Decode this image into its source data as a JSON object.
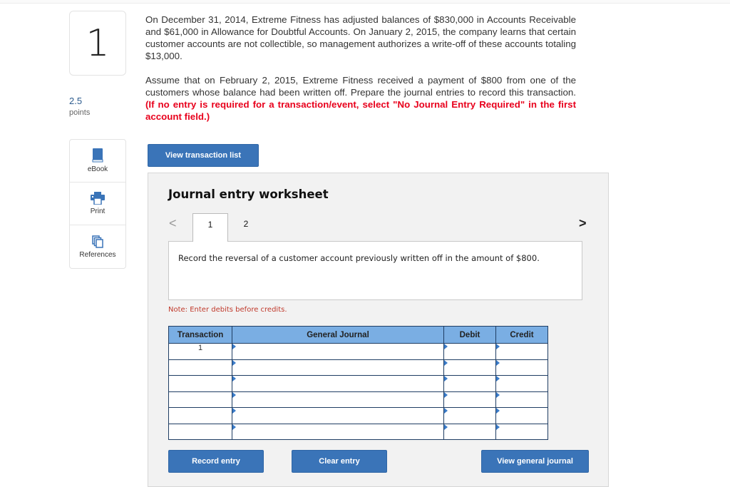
{
  "question": {
    "number": "1",
    "points_value": "2.5",
    "points_label": "points",
    "paragraph1": "On December 31, 2014, Extreme Fitness has adjusted balances of $830,000 in Accounts Receivable and $61,000 in Allowance for Doubtful Accounts. On January 2, 2015, the company learns that certain customer accounts are not collectible, so management authorizes a write-off of these accounts totaling $13,000.",
    "paragraph2_plain": "Assume that on February 2, 2015, Extreme Fitness received a payment of $800 from one of the customers whose balance had been written off. Prepare the journal entries to record this transaction.",
    "paragraph2_instruction": "(If no entry is required for a transaction/event, select \"No Journal Entry Required\" in the first account field.)"
  },
  "tools": [
    {
      "label": "eBook",
      "icon": "book-icon"
    },
    {
      "label": "Print",
      "icon": "printer-icon"
    },
    {
      "label": "References",
      "icon": "documents-icon"
    }
  ],
  "buttons": {
    "view_transaction_list": "View transaction list",
    "record_entry": "Record entry",
    "clear_entry": "Clear entry",
    "view_general_journal": "View general journal"
  },
  "worksheet": {
    "title": "Journal entry worksheet",
    "prev_arrow": "<",
    "next_arrow": ">",
    "tabs": [
      "1",
      "2"
    ],
    "active_tab": "1",
    "prompt": "Record the reversal of a customer account previously written off in the amount of $800.",
    "note": "Note: Enter debits before credits.",
    "table": {
      "headers": [
        "Transaction",
        "General Journal",
        "Debit",
        "Credit"
      ],
      "rows": [
        {
          "transaction": "1",
          "account": "",
          "debit": "",
          "credit": ""
        },
        {
          "transaction": "",
          "account": "",
          "debit": "",
          "credit": ""
        },
        {
          "transaction": "",
          "account": "",
          "debit": "",
          "credit": ""
        },
        {
          "transaction": "",
          "account": "",
          "debit": "",
          "credit": ""
        },
        {
          "transaction": "",
          "account": "",
          "debit": "",
          "credit": ""
        },
        {
          "transaction": "",
          "account": "",
          "debit": "",
          "credit": ""
        }
      ]
    }
  },
  "colors": {
    "accent_button": "#3a74b8",
    "table_header": "#7aaee3",
    "instruction_red": "#e8001c",
    "note_red": "#c0392b",
    "points_blue": "#2c5b8e"
  }
}
